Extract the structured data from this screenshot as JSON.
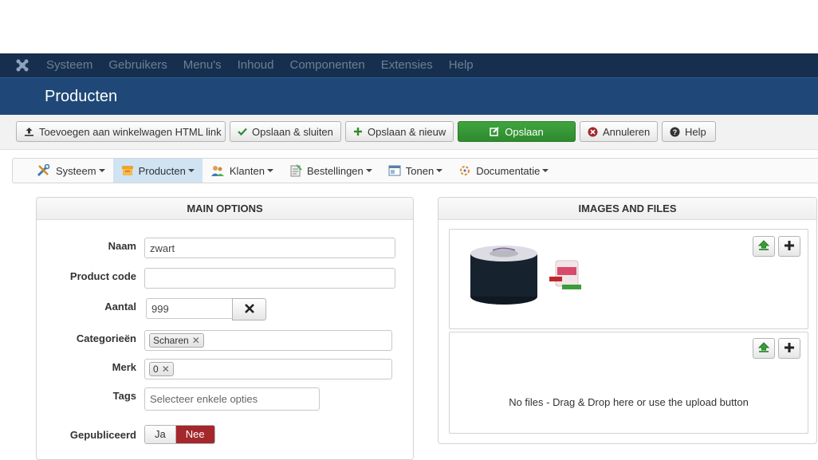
{
  "topnav": {
    "items": [
      "Systeem",
      "Gebruikers",
      "Menu's",
      "Inhoud",
      "Componenten",
      "Extensies",
      "Help"
    ]
  },
  "page": {
    "title": "Producten"
  },
  "toolbar": {
    "cart_link": "Toevoegen aan winkelwagen HTML link",
    "save_close": "Opslaan & sluiten",
    "save_new": "Opslaan & nieuw",
    "save": "Opslaan",
    "cancel": "Annuleren",
    "help": "Help"
  },
  "submenu": {
    "items": [
      "Systeem",
      "Producten",
      "Klanten",
      "Bestellingen",
      "Tonen",
      "Documentatie"
    ]
  },
  "main_options": {
    "heading": "MAIN OPTIONS",
    "name_label": "Naam",
    "name_value": "zwart",
    "code_label": "Product code",
    "code_value": "",
    "quantity_label": "Aantal",
    "quantity_value": "999",
    "categories_label": "Categorieën",
    "category_chip": "Scharen",
    "brand_label": "Merk",
    "brand_chip": "0",
    "tags_label": "Tags",
    "tags_placeholder": "Selecteer enkele opties",
    "published_label": "Gepubliceerd",
    "published_yes": "Ja",
    "published_no": "Nee"
  },
  "images_files": {
    "heading": "IMAGES AND FILES",
    "no_files_text": "No files - Drag & Drop here or use the upload button"
  },
  "colors": {
    "topbar": "#172f4e",
    "titlebar": "#1f4878",
    "save_green": "#3a9d3a",
    "no_red": "#a3272b"
  }
}
